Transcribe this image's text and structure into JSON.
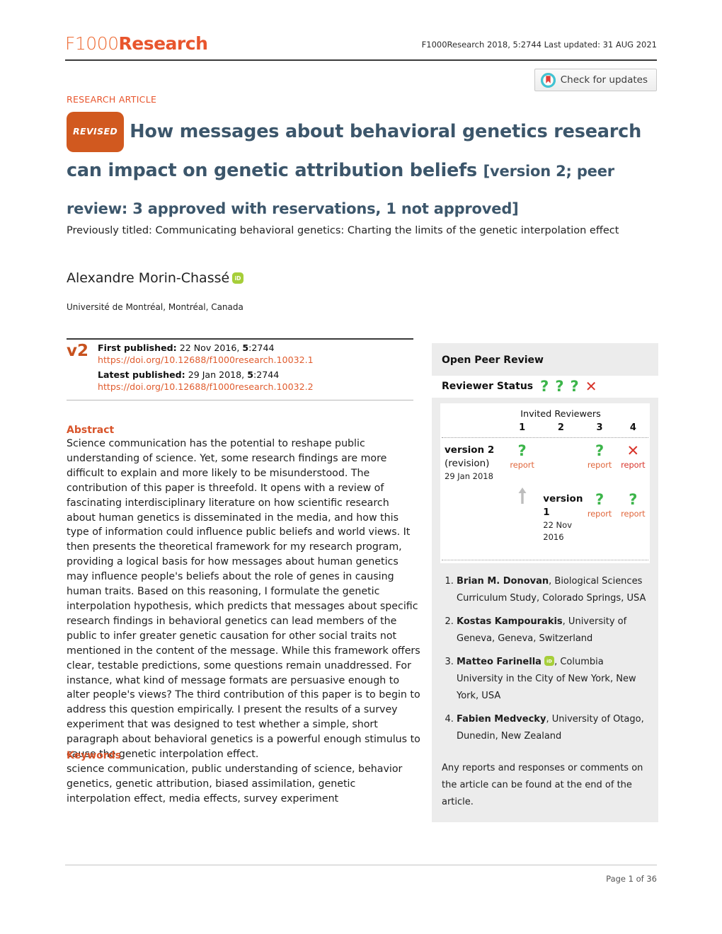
{
  "header": {
    "logo_f1000": "F1000",
    "logo_research": "Research",
    "citation": "F1000Research 2018, 5:2744 Last updated: 31 AUG 2021",
    "crossmark_label": "Check for updates"
  },
  "article": {
    "type": "RESEARCH ARTICLE",
    "revised_badge": "REVISED",
    "title_main": "How messages about behavioral genetics research can impact on genetic attribution beliefs",
    "title_version": "[version 2; peer review: 3 approved with reservations, 1 not approved]",
    "previous_title": "Previously titled: Communicating behavioral genetics: Charting the limits of the genetic interpolation effect",
    "author": "Alexandre Morin-Chassé",
    "affiliation": "Université de Montréal, Montréal, Canada"
  },
  "publication": {
    "version_tag": "v2",
    "first_published_label": "First published:",
    "first_published_value": "22 Nov 2016, ",
    "first_published_volume": "5",
    "first_published_page": ":2744",
    "first_doi": "https://doi.org/10.12688/f1000research.10032.1",
    "latest_published_label": "Latest published:",
    "latest_published_value": "29 Jan 2018, ",
    "latest_published_volume": "5",
    "latest_published_page": ":2744",
    "latest_doi": "https://doi.org/10.12688/f1000research.10032.2"
  },
  "abstract": {
    "heading": "Abstract",
    "body": "Science communication has the potential to reshape public understanding of science. Yet, some research findings are more difficult to explain and more likely to be misunderstood. The contribution of this paper is threefold. It opens with a review of fascinating interdisciplinary literature on how scientific research about human genetics is disseminated in the media, and how this type of information could influence public beliefs and world views. It then presents the theoretical framework for my research program, providing a logical basis for how messages about human genetics may influence people's beliefs about the role of genes in causing human traits. Based on this reasoning, I formulate the genetic interpolation hypothesis, which predicts that messages about specific research findings in behavioral genetics can lead members of the public to infer greater genetic causation for other social traits not mentioned in the content of the message. While this framework offers clear, testable predictions, some questions remain unaddressed. For instance, what kind of message formats are persuasive enough to alter people's views? The third contribution of this paper is to begin to address this question empirically. I present the results of a survey experiment that was designed to test whether a simple, short paragraph about behavioral genetics is a powerful enough stimulus to cause the genetic interpolation effect."
  },
  "keywords": {
    "heading": "Keywords",
    "body": "science communication, public understanding of science, behavior genetics, genetic attribution, biased assimilation, genetic interpolation effect, media effects, survey experiment"
  },
  "peer_review": {
    "panel_title": "Open Peer Review",
    "status_label": "Reviewer Status",
    "status_icons": [
      "?",
      "?",
      "?",
      "✕"
    ],
    "invited_label": "Invited Reviewers",
    "columns": [
      "1",
      "2",
      "3",
      "4"
    ],
    "versions": [
      {
        "name": "version 2",
        "sublabel": "(revision)",
        "date": "29 Jan 2018",
        "cells": [
          {
            "icon": "?",
            "status": "approved-with-reservations",
            "report": "report"
          },
          {
            "icon": "",
            "status": "none",
            "report": ""
          },
          {
            "icon": "?",
            "status": "approved-with-reservations",
            "report": "report"
          },
          {
            "icon": "✕",
            "status": "not-approved",
            "report": "report"
          }
        ]
      },
      {
        "name": "version 1",
        "sublabel": "",
        "date": "22 Nov 2016",
        "cells": [
          {
            "icon": "?",
            "status": "approved-with-reservations",
            "report": "report"
          },
          {
            "icon": "?",
            "status": "approved-with-reservations",
            "report": "report"
          },
          {
            "icon": "",
            "status": "none",
            "report": ""
          },
          {
            "icon": "",
            "status": "none",
            "report": ""
          }
        ]
      }
    ],
    "reviewers": [
      {
        "name": "Brian M. Donovan",
        "affiliation": ", Biological Sciences Curriculum Study, Colorado Springs, USA",
        "orcid": false
      },
      {
        "name": "Kostas Kampourakis",
        "affiliation": ", University of Geneva, Geneva, Switzerland",
        "orcid": false
      },
      {
        "name": "Matteo Farinella",
        "affiliation": ", Columbia University in the City of New York, New York, USA",
        "orcid": true
      },
      {
        "name": "Fabien Medvecky",
        "affiliation": ", University of Otago, Dunedin, New Zealand",
        "orcid": false
      }
    ],
    "note": "Any reports and responses or comments on the article can be found at the end of the article."
  },
  "footer": {
    "page_number": "Page 1 of 36"
  },
  "colors": {
    "brand_orange": "#e8552d",
    "title_slate": "#3c566b",
    "revised_badge": "#d1591f",
    "approved_green": "#3cb54a",
    "not_approved_red": "#d8332a",
    "report_orange": "#e0653a",
    "panel_bg": "#ececec",
    "orcid_green": "#a6ce39"
  }
}
